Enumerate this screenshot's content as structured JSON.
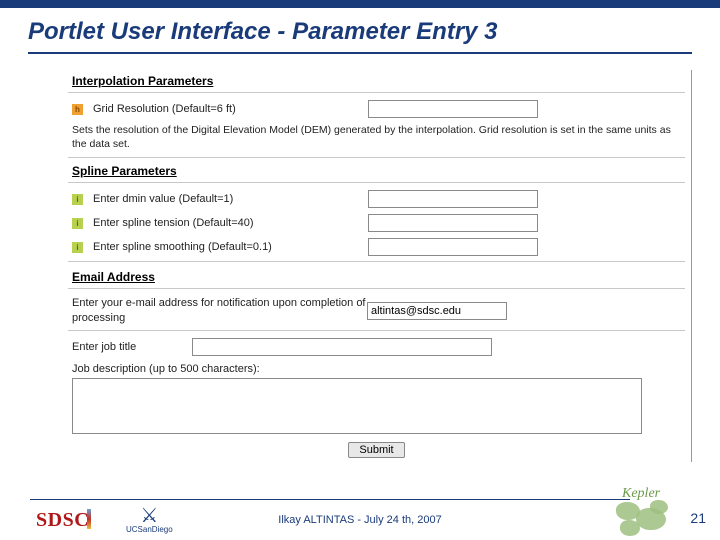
{
  "slide": {
    "title": "Portlet User Interface - Parameter Entry 3",
    "page_number": "21"
  },
  "form": {
    "interp_section": "Interpolation Parameters",
    "grid_label": "Grid Resolution (Default=6 ft)",
    "grid_value": "",
    "grid_note": "Sets the resolution of the Digital Elevation Model (DEM) generated by the interpolation. Grid resolution is set in the same units as the data set.",
    "spline_section": "Spline Parameters",
    "dmin_label": "Enter dmin value (Default=1)",
    "dmin_value": "",
    "tension_label": "Enter spline tension (Default=40)",
    "tension_value": "",
    "smoothing_label": "Enter spline smoothing (Default=0.1)",
    "smoothing_value": "",
    "email_section": "Email Address",
    "email_label": "Enter your e-mail address for notification upon completion of processing",
    "email_value": "altintas@sdsc.edu",
    "jobtitle_label": "Enter job title",
    "jobtitle_value": "",
    "jobdesc_label": "Job description (up to 500 characters):",
    "jobdesc_value": "",
    "submit_label": "Submit"
  },
  "footer": {
    "sdsc": "SDSC",
    "ucsd": "UCSanDiego",
    "caption": "Ilkay ALTINTAS - July 24 th, 2007",
    "kepler": "Kepler"
  },
  "icon_glyph": {
    "i": "i",
    "h": "h"
  }
}
